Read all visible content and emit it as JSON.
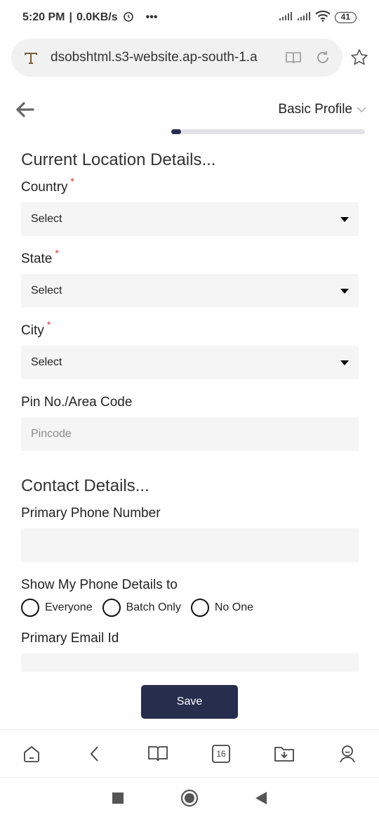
{
  "status": {
    "time": "5:20 PM",
    "speed": "0.0KB/s",
    "more": "•••",
    "battery": "41"
  },
  "browser": {
    "url": "dsobshtml.s3-website.ap-south-1.a",
    "tab_count": "16"
  },
  "header": {
    "profile_dropdown": "Basic Profile",
    "progress": 0.05
  },
  "location": {
    "title": "Current Location Details...",
    "country_label": "Country",
    "country_value": "Select",
    "state_label": "State",
    "state_value": "Select",
    "city_label": "City",
    "city_value": "Select",
    "pin_label": "Pin No./Area Code",
    "pin_placeholder": "Pincode",
    "required_mark": "*"
  },
  "contact": {
    "title": "Contact Details...",
    "phone_label": "Primary Phone Number",
    "phone_value": "",
    "visibility_label": "Show My Phone Details to",
    "visibility_options": [
      "Everyone",
      "Batch Only",
      "No One"
    ],
    "email_label": "Primary Email Id",
    "email_value": ""
  },
  "actions": {
    "save_label": "Save"
  },
  "colors": {
    "accent": "#272d4d",
    "required": "#e0323a",
    "field_bg": "#f5f5f5"
  }
}
